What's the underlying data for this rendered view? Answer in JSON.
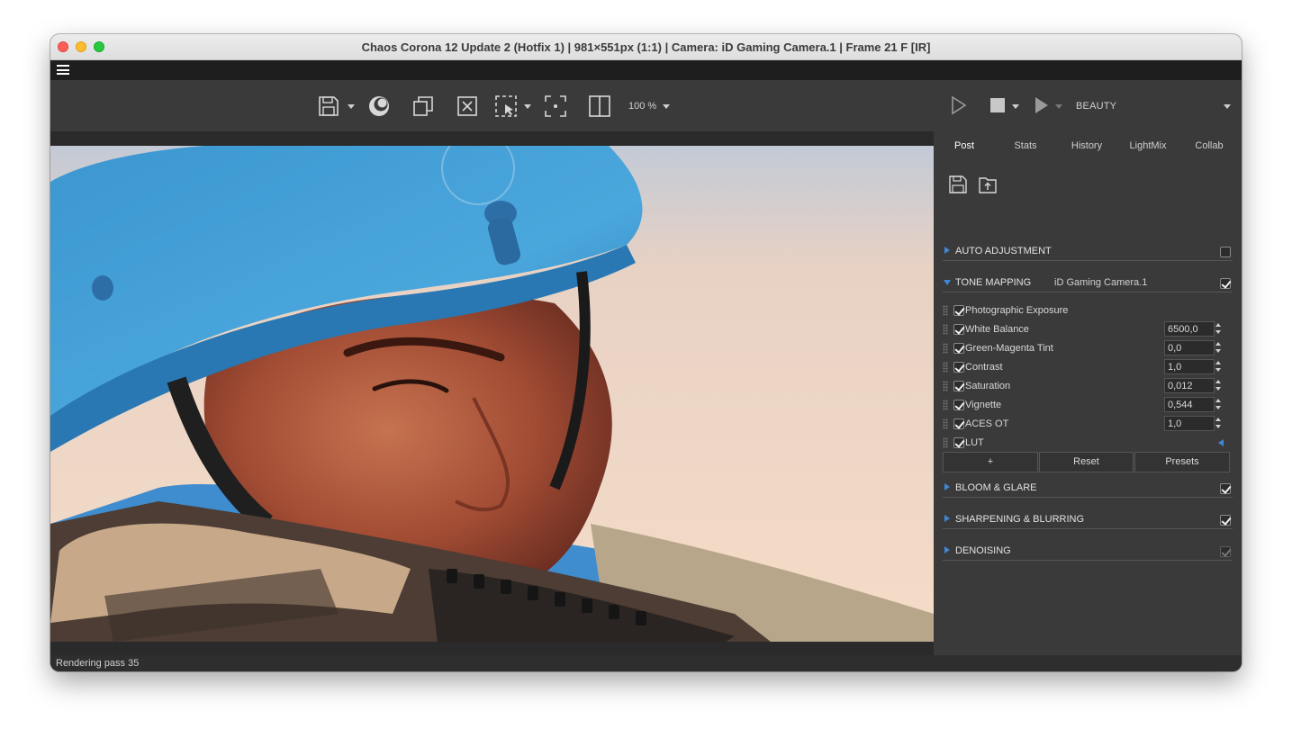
{
  "window": {
    "title": "Chaos Corona 12 Update 2 (Hotfix 1) | 981×551px (1:1) | Camera: iD Gaming Camera.1 | Frame 21 F [IR]"
  },
  "toolbar": {
    "zoom": "100 %",
    "icons": [
      "save-icon",
      "corona-logo-icon",
      "copy-icon",
      "clear-icon",
      "region-select-icon",
      "focus-point-icon",
      "split-view-icon"
    ]
  },
  "render_toolbar": {
    "pass": "BEAUTY"
  },
  "tabs": [
    {
      "label": "Post"
    },
    {
      "label": "Stats"
    },
    {
      "label": "History"
    },
    {
      "label": "LightMix"
    },
    {
      "label": "Collab"
    }
  ],
  "sections": {
    "auto_adjustment": {
      "label": "AUTO ADJUSTMENT",
      "checked": false
    },
    "tone_mapping": {
      "label": "TONE MAPPING",
      "camera": "iD Gaming Camera.1",
      "checked": true
    },
    "bloom_glare": {
      "label": "BLOOM & GLARE",
      "checked": true
    },
    "sharpening": {
      "label": "SHARPENING & BLURRING",
      "checked": true
    },
    "denoising": {
      "label": "DENOISING",
      "checked": true
    }
  },
  "tone_ops": [
    {
      "label": "Photographic Exposure",
      "value": null
    },
    {
      "label": "White Balance",
      "value": "6500,0"
    },
    {
      "label": "Green-Magenta Tint",
      "value": "0,0"
    },
    {
      "label": "Contrast",
      "value": "1,0"
    },
    {
      "label": "Saturation",
      "value": "0,012"
    },
    {
      "label": "Vignette",
      "value": "0,544"
    },
    {
      "label": "ACES OT",
      "value": "1,0"
    },
    {
      "label": "LUT",
      "value": null
    }
  ],
  "buttons": {
    "add": "+",
    "reset": "Reset",
    "presets": "Presets"
  },
  "status": {
    "text": "Rendering pass 35"
  },
  "colors": {
    "accent": "#3f86d4",
    "panel_bg": "#3a3a3a",
    "menubar_bg": "#1e1e1e"
  }
}
